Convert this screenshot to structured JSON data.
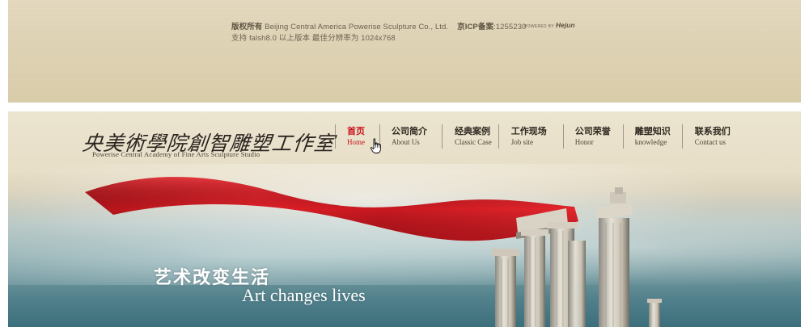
{
  "footer": {
    "line1_bold": "版权所有",
    "line1_company": "Beijing Central America Powerise Sculpture Co., Ltd.",
    "line1_icp": "京ICP备案",
    "line1_icp_num": ":1255230",
    "line2": "支持 falsh8.0 以上版本 最佳分辨率为 1024x768",
    "powered_by": "POWERED BY",
    "powered_brand": "Hejun"
  },
  "logo": {
    "cn": "央美術學院創智雕塑工作室",
    "en": "Powerise Central Academy of Fine Arts Sculpture Studio"
  },
  "nav": [
    {
      "cn": "首页",
      "en": "Home",
      "active": true
    },
    {
      "cn": "公司简介",
      "en": "About Us"
    },
    {
      "cn": "经典案例",
      "en": "Classic Case"
    },
    {
      "cn": "工作现场",
      "en": "Job site"
    },
    {
      "cn": "公司荣誉",
      "en": "Honor"
    },
    {
      "cn": "雕塑知识",
      "en": "knowledge"
    },
    {
      "cn": "联系我们",
      "en": "Contact us"
    }
  ],
  "hero": {
    "slogan_cn": "艺术改变生活",
    "slogan_en": "Art changes lives"
  },
  "colors": {
    "accent": "#c8141c",
    "ribbon": "#d81a20",
    "footer_bg": "#ddd1b2",
    "sky": "#4f7f8a"
  },
  "icons": {
    "cursor": "hand-pointer-icon"
  }
}
